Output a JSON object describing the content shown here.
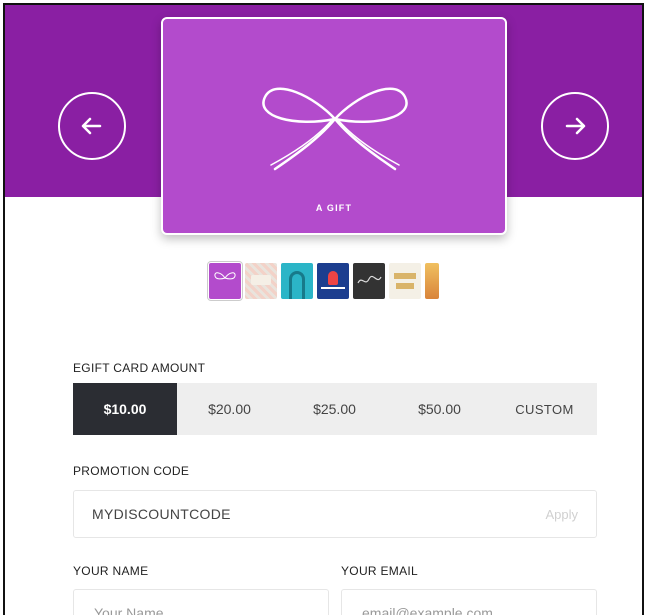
{
  "card": {
    "label": "A GIFT",
    "color": "#b34bcc",
    "banner_color": "#8a1fa3"
  },
  "nav": {
    "prev_icon": "arrow-left-icon",
    "next_icon": "arrow-right-icon"
  },
  "thumbnails": [
    {
      "name": "bow",
      "selected": true
    },
    {
      "name": "you-envelope",
      "selected": false
    },
    {
      "name": "arch",
      "selected": false
    },
    {
      "name": "blue-icon",
      "selected": false
    },
    {
      "name": "thanks-script",
      "selected": false
    },
    {
      "name": "thank-you",
      "selected": false
    },
    {
      "name": "gold",
      "selected": false
    }
  ],
  "amount_section": {
    "label": "EGIFT CARD AMOUNT",
    "options": [
      "$10.00",
      "$20.00",
      "$25.00",
      "$50.00",
      "CUSTOM"
    ],
    "selected": "$10.00"
  },
  "promo": {
    "label": "PROMOTION CODE",
    "value": "MYDISCOUNTCODE",
    "apply_label": "Apply"
  },
  "name_field": {
    "label": "YOUR NAME",
    "placeholder": "Your Name"
  },
  "email_field": {
    "label": "YOUR EMAIL",
    "placeholder": "email@example.com"
  }
}
